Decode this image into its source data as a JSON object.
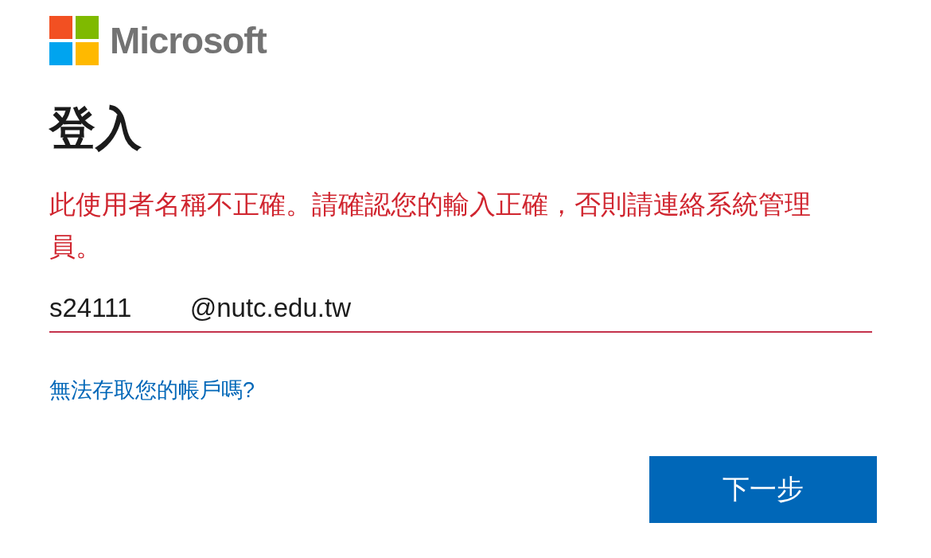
{
  "logo": {
    "text": "Microsoft"
  },
  "heading": "登入",
  "error": "此使用者名稱不正確。請確認您的輸入正確，否則請連絡系統管理員。",
  "username_field": {
    "value": "s24111        @nutc.edu.tw",
    "invalid": true
  },
  "link": "無法存取您的帳戶嗎?",
  "next_button": "下一步"
}
